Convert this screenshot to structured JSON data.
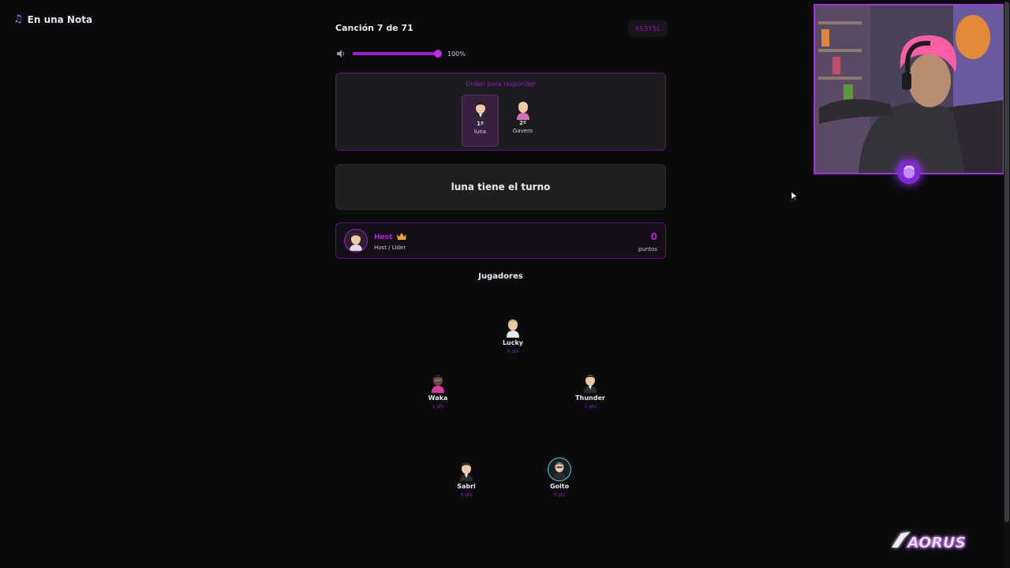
{
  "app": {
    "title": "En una Nota",
    "icon": "music-note-icon"
  },
  "game": {
    "song_counter": "Canción 7 de 71",
    "room_code": "X53Y5L"
  },
  "volume": {
    "icon": "speaker-icon",
    "level": 1.0,
    "label": "100%"
  },
  "order": {
    "title": "Orden para responder",
    "players": [
      {
        "position": "1º",
        "name": "luna",
        "active": true
      },
      {
        "position": "2º",
        "name": "Gavero",
        "active": false
      }
    ]
  },
  "turn": {
    "message": "luna tiene el turno"
  },
  "host": {
    "name": "Host",
    "role": "Host / Líder",
    "points": "0",
    "points_label": "puntos",
    "icon": "crown-icon"
  },
  "players_section": {
    "title": "Jugadores",
    "players": [
      {
        "name": "Lucky",
        "points": "0 pts"
      },
      {
        "name": "Waka",
        "points": "1 pts"
      },
      {
        "name": "Thunder",
        "points": "1 pts"
      },
      {
        "name": "Sabri",
        "points": "0 pts"
      },
      {
        "name": "Goito",
        "points": "0 pts"
      }
    ]
  },
  "overlay": {
    "logo_text": "AORUS"
  },
  "colors": {
    "accent": "#9a1fd0",
    "background": "#0b0a0d",
    "panel": "#1d1b1f",
    "ring": "#4fd3e0"
  }
}
